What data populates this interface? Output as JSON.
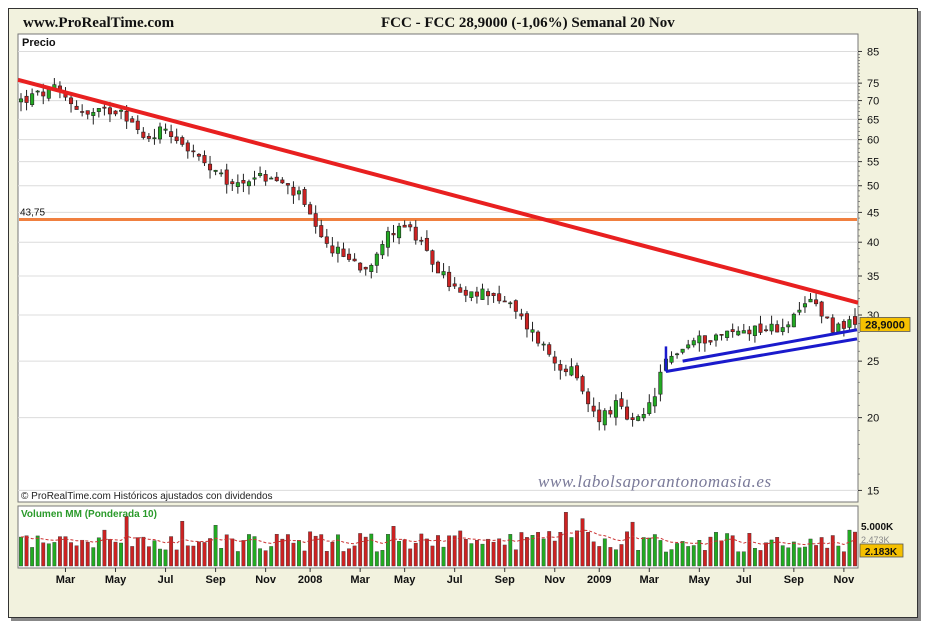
{
  "header": {
    "site": "www.ProRealTime.com",
    "quote": "FCC - FCC    28,9000 (-1,06%)    Semanal  20 Nov"
  },
  "price_panel": {
    "label": "Precio",
    "copyright": "© ProRealTime.com  Históricos ajustados con dividendos",
    "watermark": "www.labolsaporantonomasia.es",
    "last_price_label": "28,9000",
    "resistance_label": "43,75"
  },
  "volume_panel": {
    "label": "Volumen MM (Ponderada 10)",
    "tick_label": "5.000K",
    "ma_label": "2.473K",
    "last_label": "2.183K"
  },
  "colors": {
    "background": "#f2f2de",
    "panel": "#ffffff",
    "up": "#22aa22",
    "down": "#cc2222",
    "trendline": "#e82020",
    "resistance": "#f08040",
    "channel": "#1a1acc",
    "label_bg": "#f5c000"
  },
  "chart_data": {
    "type": "candlestick",
    "title": "FCC - FCC",
    "period": "Semanal",
    "last_close": 28.9,
    "change_percent": -1.06,
    "y_scale": "log",
    "ylim": [
      14.5,
      90
    ],
    "y_ticks": [
      15,
      20,
      25,
      30,
      35,
      40,
      45,
      50,
      55,
      60,
      65,
      70,
      75,
      85
    ],
    "x_ticks": [
      "Mar",
      "May",
      "Jul",
      "Sep",
      "Nov",
      "2008",
      "Mar",
      "May",
      "Jul",
      "Sep",
      "Nov",
      "2009",
      "Mar",
      "May",
      "Jul",
      "Sep",
      "Nov"
    ],
    "x_tick_weeks": [
      8,
      17,
      26,
      35,
      44,
      52,
      61,
      69,
      78,
      87,
      96,
      104,
      113,
      122,
      130,
      139,
      148
    ],
    "weeks_total": 151,
    "close_path": [
      [
        0,
        70
      ],
      [
        6,
        73
      ],
      [
        12,
        66
      ],
      [
        18,
        68
      ],
      [
        22,
        60
      ],
      [
        26,
        63
      ],
      [
        30,
        58
      ],
      [
        34,
        53
      ],
      [
        38,
        50
      ],
      [
        42,
        52
      ],
      [
        46,
        51
      ],
      [
        50,
        48
      ],
      [
        54,
        40
      ],
      [
        58,
        38
      ],
      [
        62,
        36
      ],
      [
        65,
        40
      ],
      [
        68,
        43
      ],
      [
        70,
        42
      ],
      [
        73,
        38
      ],
      [
        77,
        34
      ],
      [
        80,
        32
      ],
      [
        84,
        33
      ],
      [
        88,
        31
      ],
      [
        92,
        28
      ],
      [
        96,
        25
      ],
      [
        99,
        24
      ],
      [
        102,
        21
      ],
      [
        104,
        20
      ],
      [
        107,
        21
      ],
      [
        110,
        19.5
      ],
      [
        112,
        20
      ],
      [
        114,
        22
      ],
      [
        116,
        25
      ],
      [
        118,
        26
      ],
      [
        121,
        27
      ],
      [
        124,
        27.5
      ],
      [
        128,
        28
      ],
      [
        132,
        28.5
      ],
      [
        136,
        28.5
      ],
      [
        140,
        30
      ],
      [
        142,
        32
      ],
      [
        144,
        30.5
      ],
      [
        146,
        28.5
      ],
      [
        148,
        29
      ],
      [
        150,
        28.9
      ]
    ],
    "trendline": [
      [
        0,
        76
      ],
      [
        151,
        31.5
      ]
    ],
    "resistance_level": 43.75,
    "support_channel": [
      [
        [
          116,
          24
        ],
        [
          151,
          27.3
        ]
      ],
      [
        [
          119,
          25
        ],
        [
          151,
          28.3
        ]
      ]
    ],
    "volume": {
      "unit": "K",
      "ylim": [
        0,
        6500
      ],
      "ma_label_value": 2473,
      "last_value": 2183
    }
  }
}
